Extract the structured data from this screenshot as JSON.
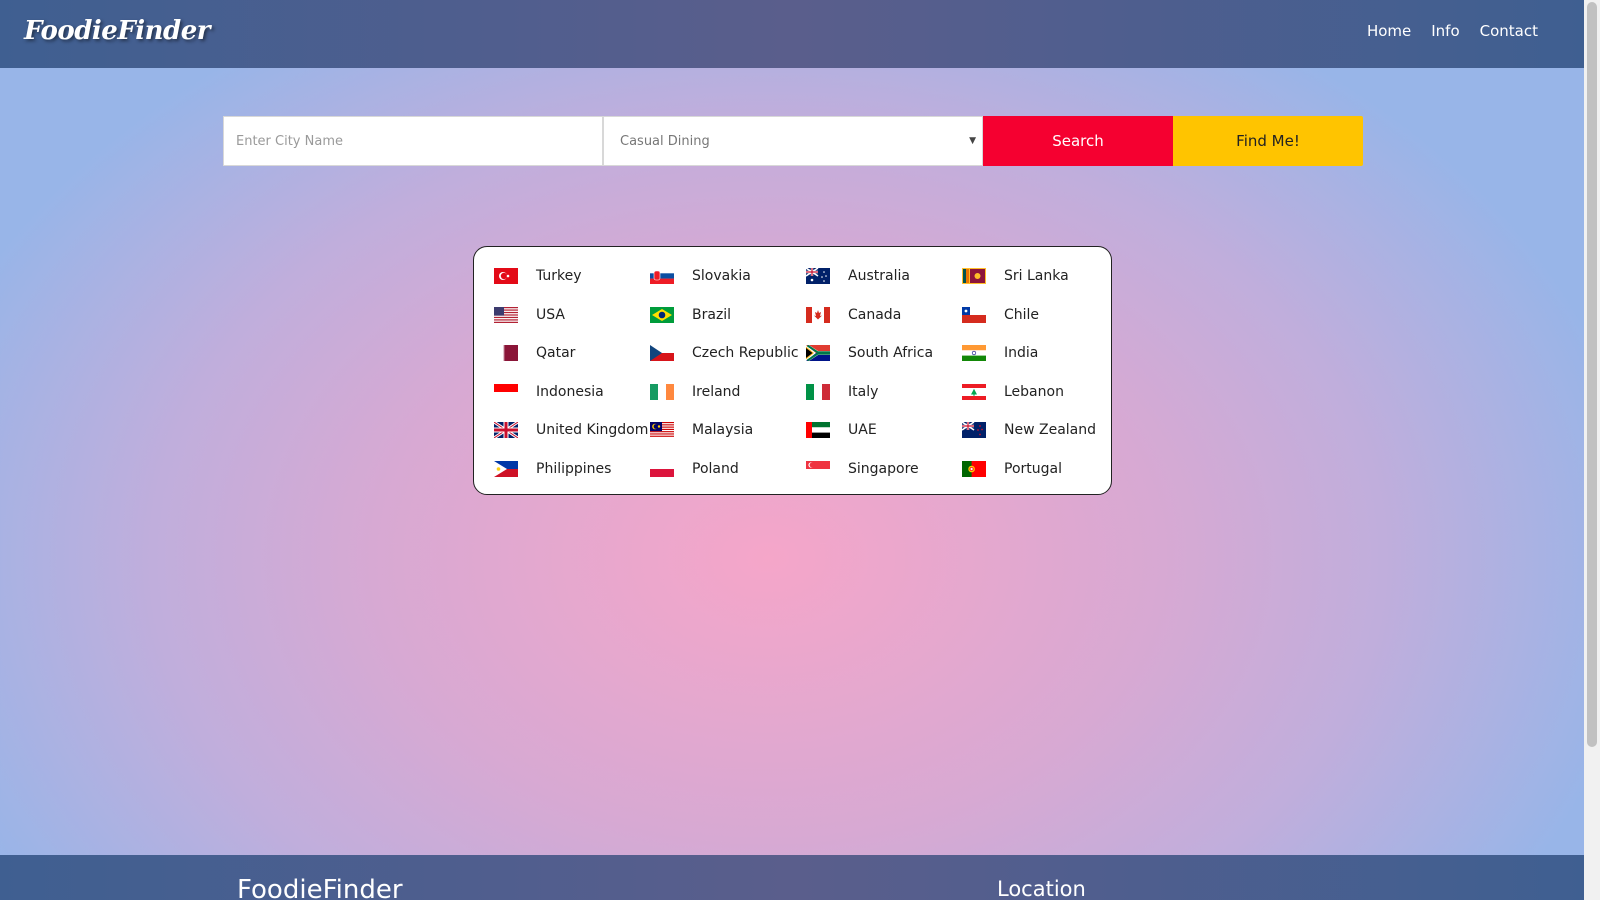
{
  "header": {
    "logo": "FoodieFinder",
    "nav": [
      "Home",
      "Info",
      "Contact"
    ]
  },
  "search": {
    "city_placeholder": "Enter City Name",
    "cuisine_selected": "Casual Dining",
    "search_label": "Search",
    "find_label": "Find Me!"
  },
  "countries": [
    [
      "Turkey",
      "Slovakia",
      "Australia",
      "Sri Lanka"
    ],
    [
      "USA",
      "Brazil",
      "Canada",
      "Chile"
    ],
    [
      "Qatar",
      "Czech Republic",
      "South Africa",
      "India"
    ],
    [
      "Indonesia",
      "Ireland",
      "Italy",
      "Lebanon"
    ],
    [
      "United Kingdom",
      "Malaysia",
      "UAE",
      "New Zealand"
    ],
    [
      "Philippines",
      "Poland",
      "Singapore",
      "Portugal"
    ]
  ],
  "footer": {
    "brand": "FoodieFinder",
    "location_heading": "Location"
  },
  "colors": {
    "header": "#4a5f8f",
    "search_button": "#f50030",
    "find_button": "#ffc400"
  }
}
